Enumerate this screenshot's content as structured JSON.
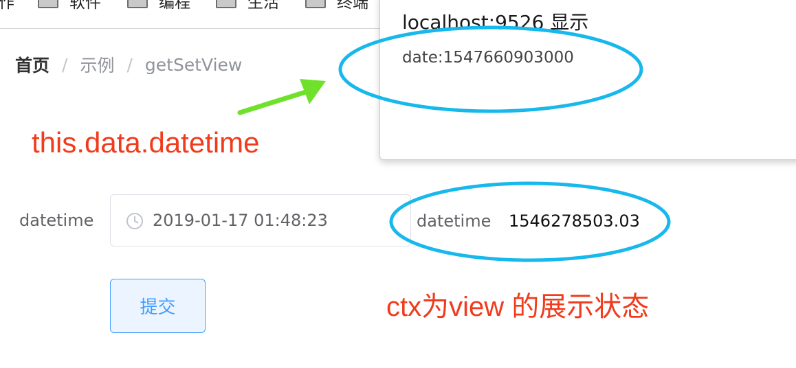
{
  "bookmarks": [
    {
      "label": "作"
    },
    {
      "label": "软件"
    },
    {
      "label": "编程"
    },
    {
      "label": "生活"
    },
    {
      "label": "终端"
    }
  ],
  "breadcrumb": {
    "home": "首页",
    "examples": "示例",
    "current": "getSetView",
    "separator": "/"
  },
  "annotations": {
    "datetime": "this.data.datetime",
    "ctx": "ctx为view 的展示状态"
  },
  "form": {
    "label": "datetime",
    "input_value": "2019-01-17 01:48:23",
    "view_label": "datetime",
    "view_value": "1546278503.03",
    "submit_label": "提交"
  },
  "dialog": {
    "title": "localhost:9526 显示",
    "message": "date:1547660903000"
  },
  "colors": {
    "accent": "#409eff",
    "annotation": "#f03b1c",
    "ellipse": "#17b8ec",
    "arrow": "#6fe12a"
  }
}
